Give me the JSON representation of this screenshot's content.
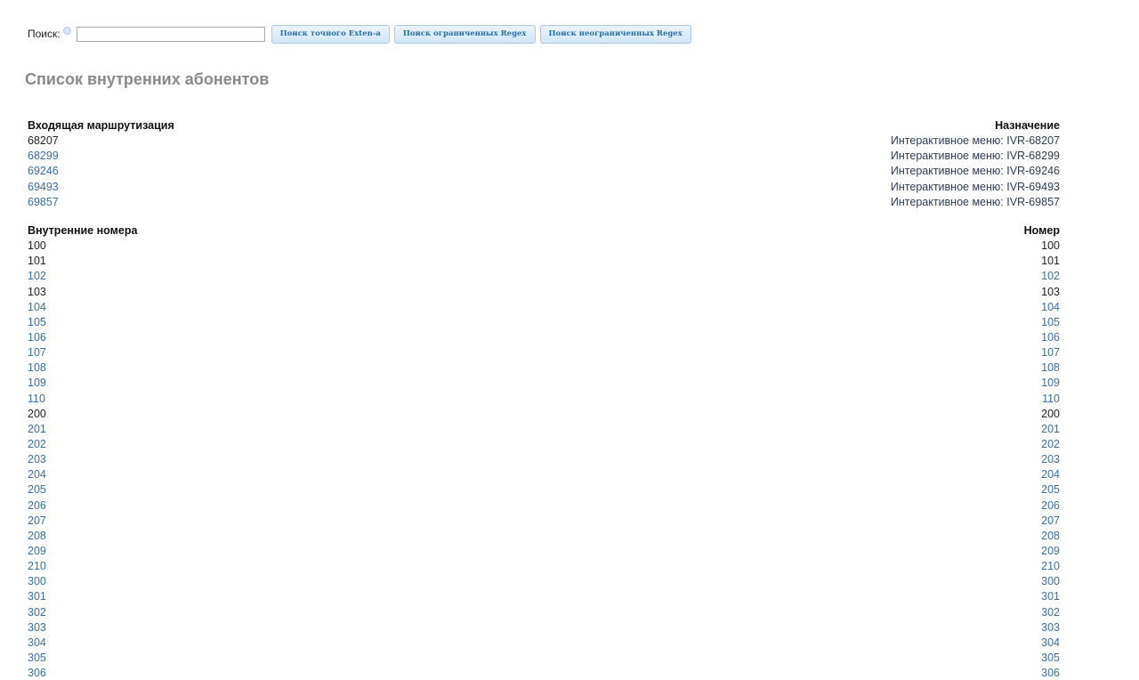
{
  "search": {
    "label": "Поиск:",
    "input_value": "",
    "buttons": [
      "Поиск точного Exten-a",
      "Поиск ограниченных Regex",
      "Поиск неограниченных Regex"
    ]
  },
  "page_title": "Список внутренних абонентов",
  "inbound": {
    "col_left": "Входящая маршрутизация",
    "col_right": "Назначение",
    "rows": [
      {
        "number": "68207",
        "dest": "Интерактивное меню: IVR-68207",
        "link": false
      },
      {
        "number": "68299",
        "dest": "Интерактивное меню: IVR-68299",
        "link": true
      },
      {
        "number": "69246",
        "dest": "Интерактивное меню: IVR-69246",
        "link": true
      },
      {
        "number": "69493",
        "dest": "Интерактивное меню: IVR-69493",
        "link": true
      },
      {
        "number": "69857",
        "dest": "Интерактивное меню: IVR-69857",
        "link": true
      }
    ]
  },
  "extensions": {
    "col_left": "Внутренние номера",
    "col_right": "Номер",
    "rows": [
      {
        "number": "100",
        "link": false
      },
      {
        "number": "101",
        "link": false
      },
      {
        "number": "102",
        "link": true
      },
      {
        "number": "103",
        "link": false
      },
      {
        "number": "104",
        "link": true
      },
      {
        "number": "105",
        "link": true
      },
      {
        "number": "106",
        "link": true
      },
      {
        "number": "107",
        "link": true
      },
      {
        "number": "108",
        "link": true
      },
      {
        "number": "109",
        "link": true
      },
      {
        "number": "110",
        "link": true
      },
      {
        "number": "200",
        "link": false
      },
      {
        "number": "201",
        "link": true
      },
      {
        "number": "202",
        "link": true
      },
      {
        "number": "203",
        "link": true
      },
      {
        "number": "204",
        "link": true
      },
      {
        "number": "205",
        "link": true
      },
      {
        "number": "206",
        "link": true
      },
      {
        "number": "207",
        "link": true
      },
      {
        "number": "208",
        "link": true
      },
      {
        "number": "209",
        "link": true
      },
      {
        "number": "210",
        "link": true
      },
      {
        "number": "300",
        "link": true
      },
      {
        "number": "301",
        "link": true
      },
      {
        "number": "302",
        "link": true
      },
      {
        "number": "303",
        "link": true
      },
      {
        "number": "304",
        "link": true
      },
      {
        "number": "305",
        "link": true
      },
      {
        "number": "306",
        "link": true
      }
    ]
  },
  "colors": {
    "link": "#3a6fa3",
    "title": "#8a8a8a",
    "button_text": "#2a6ea8"
  }
}
